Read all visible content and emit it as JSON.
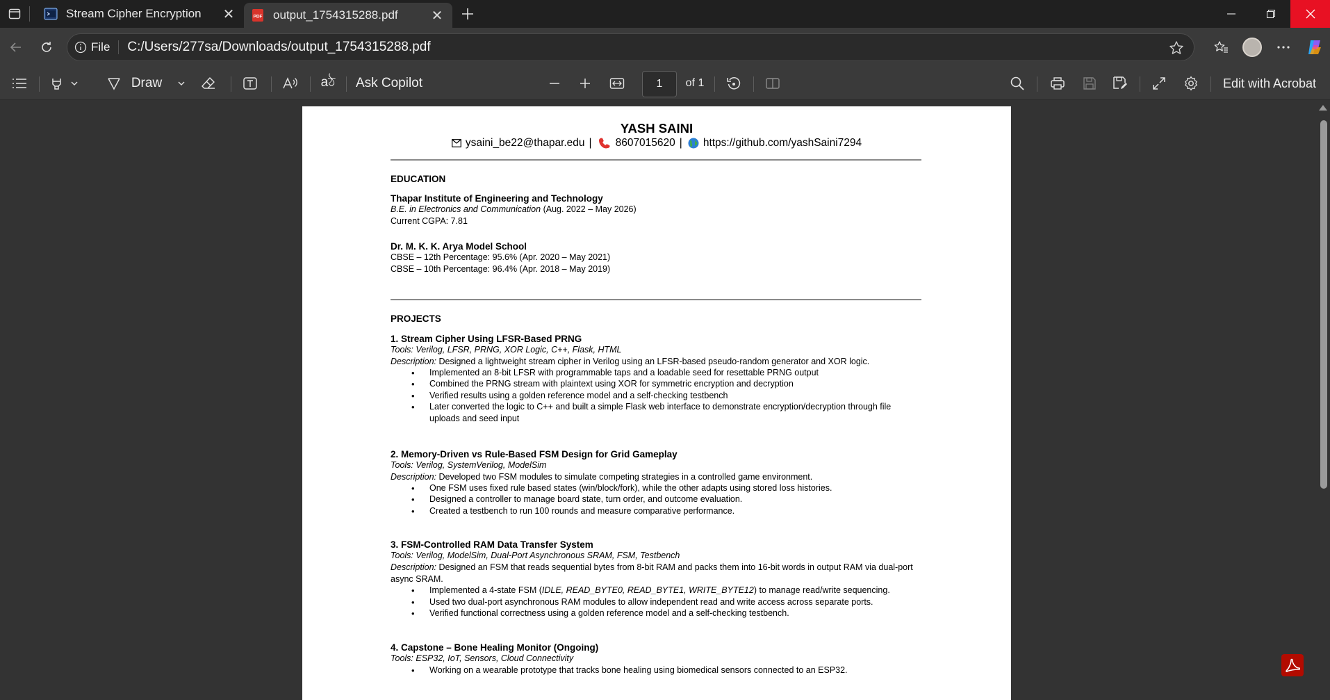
{
  "browser": {
    "tabs": [
      {
        "title": "Stream Cipher Encryption"
      },
      {
        "title": "output_1754315288.pdf"
      }
    ],
    "address": {
      "scheme_label": "File",
      "url": "C:/Users/277sa/Downloads/output_1754315288.pdf"
    }
  },
  "pdf_toolbar": {
    "draw_label": "Draw",
    "ask_copilot_label": "Ask Copilot",
    "page_current": "1",
    "page_total_label": "of 1",
    "edit_acrobat_label": "Edit with Acrobat"
  },
  "resume": {
    "name": "YASH SAINI",
    "email": "ysaini_be22@thapar.edu",
    "phone": "8607015620",
    "github": "https://github.com/yashSaini7294",
    "sep": "|",
    "education": {
      "heading": "EDUCATION",
      "entries": [
        {
          "school": "Thapar Institute of Engineering and Technology",
          "degree": "B.E. in Electronics and Communication",
          "dates": "(Aug. 2022 – May 2026)",
          "line2": "Current CGPA: 7.81"
        },
        {
          "school": "Dr. M. K. K. Arya Model School",
          "line1": "CBSE – 12th Percentage: 95.6% (Apr. 2020 – May 2021)",
          "line2": "CBSE – 10th Percentage: 96.4% (Apr. 2018 – May 2019)"
        }
      ]
    },
    "projects": {
      "heading": "PROJECTS",
      "desc_label": "Description:",
      "items": [
        {
          "title": " 1. Stream Cipher Using LFSR-Based PRNG",
          "tools": "Tools: Verilog, LFSR, PRNG, XOR Logic, C++, Flask, HTML",
          "description": " Designed a lightweight stream cipher in Verilog using an LFSR-based pseudo-random generator and XOR logic.",
          "bullets": [
            "Implemented an 8-bit LFSR with programmable taps and a loadable seed for resettable PRNG output",
            "Combined the PRNG stream with plaintext using XOR for symmetric encryption and decryption",
            "Verified results using a golden reference model and a self-checking testbench",
            "Later converted the logic to C++ and built a simple Flask web interface to demonstrate encryption/decryption through file uploads and seed input"
          ]
        },
        {
          "title": "2. Memory-Driven vs Rule-Based FSM Design for Grid Gameplay",
          "tools": "Tools: Verilog, SystemVerilog, ModelSim",
          "description": " Developed two FSM modules to simulate competing strategies in a controlled game environment.",
          "bullets": [
            "One FSM uses fixed rule based states (win/block/fork), while the other adapts using stored loss histories.",
            "Designed a controller to manage board state, turn order, and outcome evaluation.",
            "Created a testbench to run 100 rounds and measure comparative performance."
          ]
        },
        {
          "title": "3. FSM-Controlled RAM Data Transfer System",
          "tools": "Tools: Verilog, ModelSim, Dual-Port Asynchronous SRAM, FSM, Testbench",
          "description": " Designed an FSM that reads sequential bytes from 8-bit RAM and packs them into 16-bit words in output RAM via dual-port async SRAM.",
          "bullet0_pre": "Implemented a 4-state FSM (",
          "bullet0_em": "IDLE, READ_BYTE0, READ_BYTE1, WRITE_BYTE12",
          "bullet0_post": ") to manage read/write sequencing.",
          "bullets": [
            "Used two dual-port asynchronous RAM modules to allow independent read and write access across separate ports.",
            "Verified functional correctness using a golden reference model and a self-checking testbench."
          ]
        },
        {
          "title": "4. Capstone – Bone Healing Monitor (Ongoing)",
          "tools": "Tools: ESP32, IoT, Sensors, Cloud Connectivity",
          "bullets": [
            "Working on a wearable prototype that tracks bone healing using biomedical sensors connected to an ESP32."
          ]
        }
      ]
    }
  },
  "colors": {
    "accent_close": "#e81123",
    "acrobat_red": "#b30b00",
    "phone_red": "#e0332f"
  }
}
